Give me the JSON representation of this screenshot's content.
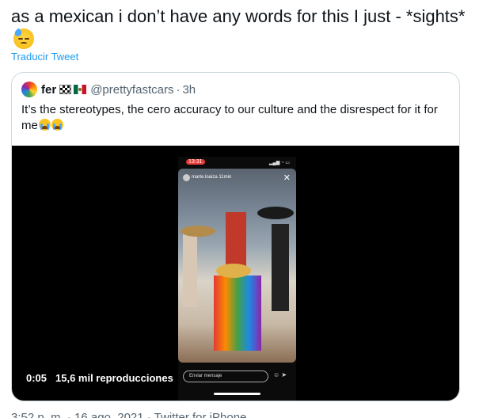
{
  "tweet": {
    "text": "as a mexican i don’t have any words for this I just - *sights*",
    "emoji": "sad-but-relieved-face-icon",
    "translate_label": "Traducir Tweet"
  },
  "quoted_tweet": {
    "display_name": "fer",
    "handle": "@prettyfastcars",
    "separator": "·",
    "time": "3h",
    "text": "It’s the stereotypes, the cero accuracy to our culture and the disrespect for it for me",
    "video": {
      "duration": "0:05",
      "views": "15,6 mil reproducciones",
      "story_time": "13:31",
      "story_user": "marte.loaiza 11min",
      "message_placeholder": "Enviar mensaje"
    }
  },
  "meta": {
    "text": "3:52 p. m. · 16 ago. 2021 · Twitter for iPhone"
  },
  "colors": {
    "link": "#1d9bf0",
    "secondary_text": "#536471",
    "border": "#cfd9de"
  }
}
